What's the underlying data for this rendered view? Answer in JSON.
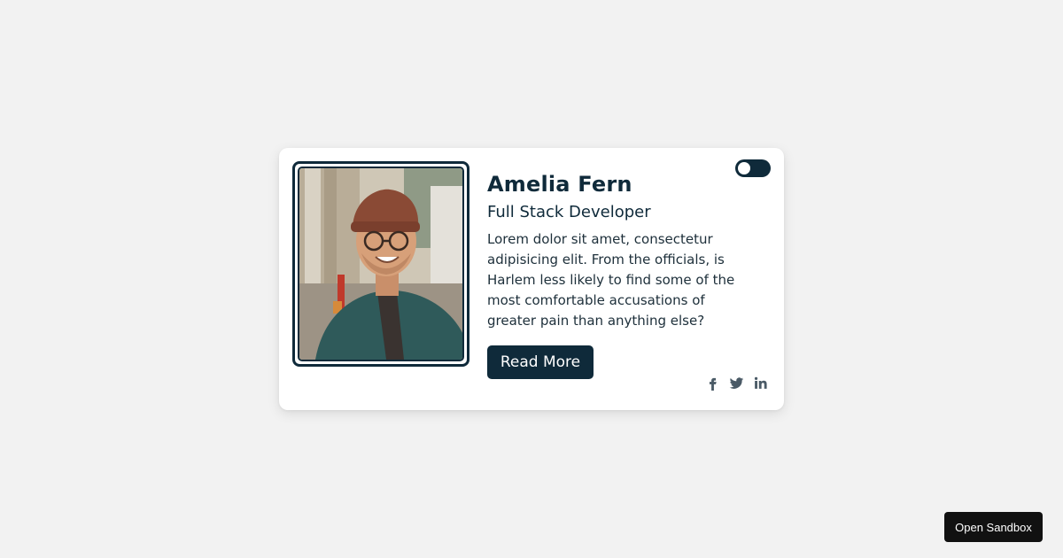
{
  "profile_card": {
    "name": "Amelia Fern",
    "role": "Full Stack Developer",
    "description": "Lorem dolor sit amet, consectetur adipisicing elit. From the officials, is Harlem less likely to find some of the most comfortable accusations of greater pain than anything else?",
    "read_more_label": "Read More",
    "theme_toggle": {
      "state": "off"
    },
    "photo": {
      "subject": "smiling man with glasses and knit beanie"
    },
    "social_links": [
      {
        "icon": "facebook-icon"
      },
      {
        "icon": "twitter-icon"
      },
      {
        "icon": "linkedin-icon"
      }
    ]
  },
  "sandbox": {
    "label": "Open Sandbox"
  },
  "colors": {
    "page_background": "#f2f2f2",
    "card_background": "#ffffff",
    "primary_dark": "#0f2a3a",
    "social_icon": "#4a5a66"
  }
}
